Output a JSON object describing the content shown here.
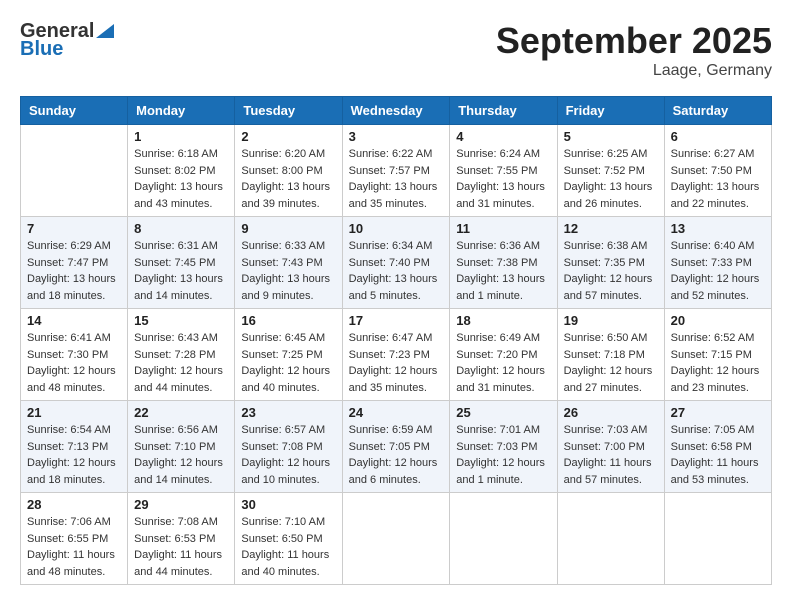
{
  "header": {
    "logo_line1": "General",
    "logo_line2": "Blue",
    "month_title": "September 2025",
    "location": "Laage, Germany"
  },
  "days_of_week": [
    "Sunday",
    "Monday",
    "Tuesday",
    "Wednesday",
    "Thursday",
    "Friday",
    "Saturday"
  ],
  "weeks": [
    [
      {
        "day": "",
        "sunrise": "",
        "sunset": "",
        "daylight": ""
      },
      {
        "day": "1",
        "sunrise": "Sunrise: 6:18 AM",
        "sunset": "Sunset: 8:02 PM",
        "daylight": "Daylight: 13 hours and 43 minutes."
      },
      {
        "day": "2",
        "sunrise": "Sunrise: 6:20 AM",
        "sunset": "Sunset: 8:00 PM",
        "daylight": "Daylight: 13 hours and 39 minutes."
      },
      {
        "day": "3",
        "sunrise": "Sunrise: 6:22 AM",
        "sunset": "Sunset: 7:57 PM",
        "daylight": "Daylight: 13 hours and 35 minutes."
      },
      {
        "day": "4",
        "sunrise": "Sunrise: 6:24 AM",
        "sunset": "Sunset: 7:55 PM",
        "daylight": "Daylight: 13 hours and 31 minutes."
      },
      {
        "day": "5",
        "sunrise": "Sunrise: 6:25 AM",
        "sunset": "Sunset: 7:52 PM",
        "daylight": "Daylight: 13 hours and 26 minutes."
      },
      {
        "day": "6",
        "sunrise": "Sunrise: 6:27 AM",
        "sunset": "Sunset: 7:50 PM",
        "daylight": "Daylight: 13 hours and 22 minutes."
      }
    ],
    [
      {
        "day": "7",
        "sunrise": "Sunrise: 6:29 AM",
        "sunset": "Sunset: 7:47 PM",
        "daylight": "Daylight: 13 hours and 18 minutes."
      },
      {
        "day": "8",
        "sunrise": "Sunrise: 6:31 AM",
        "sunset": "Sunset: 7:45 PM",
        "daylight": "Daylight: 13 hours and 14 minutes."
      },
      {
        "day": "9",
        "sunrise": "Sunrise: 6:33 AM",
        "sunset": "Sunset: 7:43 PM",
        "daylight": "Daylight: 13 hours and 9 minutes."
      },
      {
        "day": "10",
        "sunrise": "Sunrise: 6:34 AM",
        "sunset": "Sunset: 7:40 PM",
        "daylight": "Daylight: 13 hours and 5 minutes."
      },
      {
        "day": "11",
        "sunrise": "Sunrise: 6:36 AM",
        "sunset": "Sunset: 7:38 PM",
        "daylight": "Daylight: 13 hours and 1 minute."
      },
      {
        "day": "12",
        "sunrise": "Sunrise: 6:38 AM",
        "sunset": "Sunset: 7:35 PM",
        "daylight": "Daylight: 12 hours and 57 minutes."
      },
      {
        "day": "13",
        "sunrise": "Sunrise: 6:40 AM",
        "sunset": "Sunset: 7:33 PM",
        "daylight": "Daylight: 12 hours and 52 minutes."
      }
    ],
    [
      {
        "day": "14",
        "sunrise": "Sunrise: 6:41 AM",
        "sunset": "Sunset: 7:30 PM",
        "daylight": "Daylight: 12 hours and 48 minutes."
      },
      {
        "day": "15",
        "sunrise": "Sunrise: 6:43 AM",
        "sunset": "Sunset: 7:28 PM",
        "daylight": "Daylight: 12 hours and 44 minutes."
      },
      {
        "day": "16",
        "sunrise": "Sunrise: 6:45 AM",
        "sunset": "Sunset: 7:25 PM",
        "daylight": "Daylight: 12 hours and 40 minutes."
      },
      {
        "day": "17",
        "sunrise": "Sunrise: 6:47 AM",
        "sunset": "Sunset: 7:23 PM",
        "daylight": "Daylight: 12 hours and 35 minutes."
      },
      {
        "day": "18",
        "sunrise": "Sunrise: 6:49 AM",
        "sunset": "Sunset: 7:20 PM",
        "daylight": "Daylight: 12 hours and 31 minutes."
      },
      {
        "day": "19",
        "sunrise": "Sunrise: 6:50 AM",
        "sunset": "Sunset: 7:18 PM",
        "daylight": "Daylight: 12 hours and 27 minutes."
      },
      {
        "day": "20",
        "sunrise": "Sunrise: 6:52 AM",
        "sunset": "Sunset: 7:15 PM",
        "daylight": "Daylight: 12 hours and 23 minutes."
      }
    ],
    [
      {
        "day": "21",
        "sunrise": "Sunrise: 6:54 AM",
        "sunset": "Sunset: 7:13 PM",
        "daylight": "Daylight: 12 hours and 18 minutes."
      },
      {
        "day": "22",
        "sunrise": "Sunrise: 6:56 AM",
        "sunset": "Sunset: 7:10 PM",
        "daylight": "Daylight: 12 hours and 14 minutes."
      },
      {
        "day": "23",
        "sunrise": "Sunrise: 6:57 AM",
        "sunset": "Sunset: 7:08 PM",
        "daylight": "Daylight: 12 hours and 10 minutes."
      },
      {
        "day": "24",
        "sunrise": "Sunrise: 6:59 AM",
        "sunset": "Sunset: 7:05 PM",
        "daylight": "Daylight: 12 hours and 6 minutes."
      },
      {
        "day": "25",
        "sunrise": "Sunrise: 7:01 AM",
        "sunset": "Sunset: 7:03 PM",
        "daylight": "Daylight: 12 hours and 1 minute."
      },
      {
        "day": "26",
        "sunrise": "Sunrise: 7:03 AM",
        "sunset": "Sunset: 7:00 PM",
        "daylight": "Daylight: 11 hours and 57 minutes."
      },
      {
        "day": "27",
        "sunrise": "Sunrise: 7:05 AM",
        "sunset": "Sunset: 6:58 PM",
        "daylight": "Daylight: 11 hours and 53 minutes."
      }
    ],
    [
      {
        "day": "28",
        "sunrise": "Sunrise: 7:06 AM",
        "sunset": "Sunset: 6:55 PM",
        "daylight": "Daylight: 11 hours and 48 minutes."
      },
      {
        "day": "29",
        "sunrise": "Sunrise: 7:08 AM",
        "sunset": "Sunset: 6:53 PM",
        "daylight": "Daylight: 11 hours and 44 minutes."
      },
      {
        "day": "30",
        "sunrise": "Sunrise: 7:10 AM",
        "sunset": "Sunset: 6:50 PM",
        "daylight": "Daylight: 11 hours and 40 minutes."
      },
      {
        "day": "",
        "sunrise": "",
        "sunset": "",
        "daylight": ""
      },
      {
        "day": "",
        "sunrise": "",
        "sunset": "",
        "daylight": ""
      },
      {
        "day": "",
        "sunrise": "",
        "sunset": "",
        "daylight": ""
      },
      {
        "day": "",
        "sunrise": "",
        "sunset": "",
        "daylight": ""
      }
    ]
  ]
}
